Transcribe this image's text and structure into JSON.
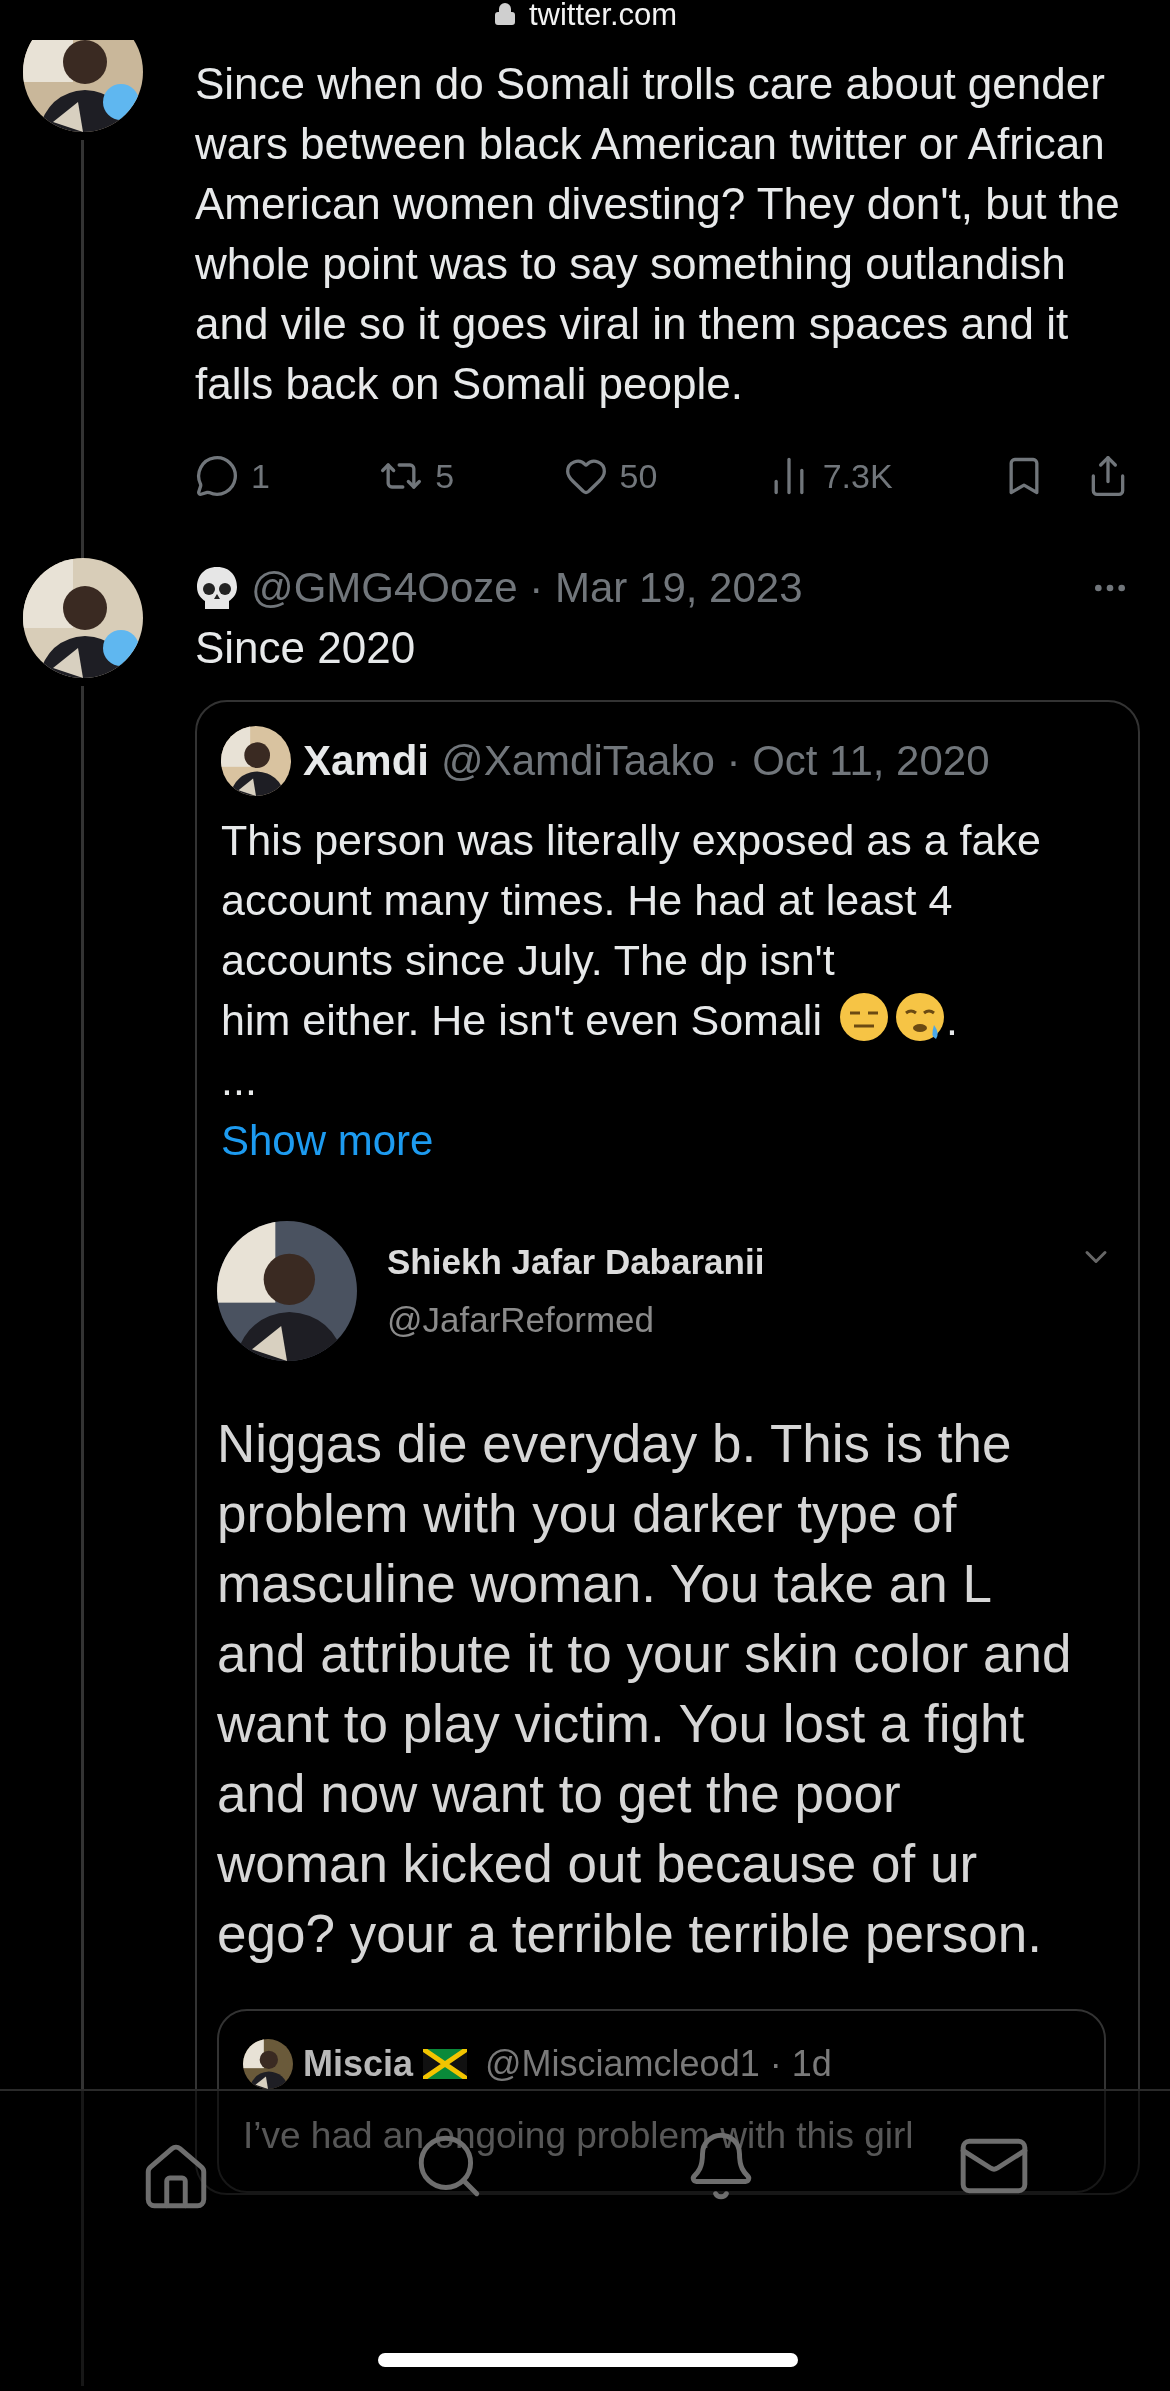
{
  "browser": {
    "url": "twitter.com"
  },
  "thread": [
    {
      "body": "Since when do Somali trolls care about gender wars between black American twitter or African American women divesting? They don't, but the whole point was to say something outlandish and vile so it goes viral in them spaces and it falls back on Somali people.",
      "actions": {
        "replies": "1",
        "retweets": "5",
        "likes": "50",
        "views": "7.3K"
      }
    },
    {
      "meta": "@GMG4Ooze · Mar 19, 2023",
      "body": "Since 2020",
      "quote": {
        "name": "Xamdi",
        "meta": "@XamdiTaako · Oct 11, 2020",
        "body": "This person was literally exposed as a fake account many times. He had at least 4 accounts since July. The dp isn't",
        "body_last": "him either. He isn't even Somali",
        "body_end": ".",
        "ellipsis": "...",
        "show_more": "Show more",
        "screenshot": {
          "name": "Shiekh Jafar Dabaranii",
          "handle": "@JafarReformed",
          "body": "Niggas die everyday b. This is the problem with you darker type of masculine woman. You take an L and attribute it to your skin color and want to play victim. You lost a fight and now want to get the poor woman kicked out because of ur ego? your a terrible terrible person.",
          "quote": {
            "name": "Miscia",
            "meta": "@Misciamcleod1 · 1d",
            "body": "I’ve had an ongoing problem with this girl"
          }
        }
      }
    }
  ],
  "nav": [
    {
      "kind": "home"
    },
    {
      "kind": "search"
    },
    {
      "kind": "notifications"
    },
    {
      "kind": "messages"
    }
  ]
}
